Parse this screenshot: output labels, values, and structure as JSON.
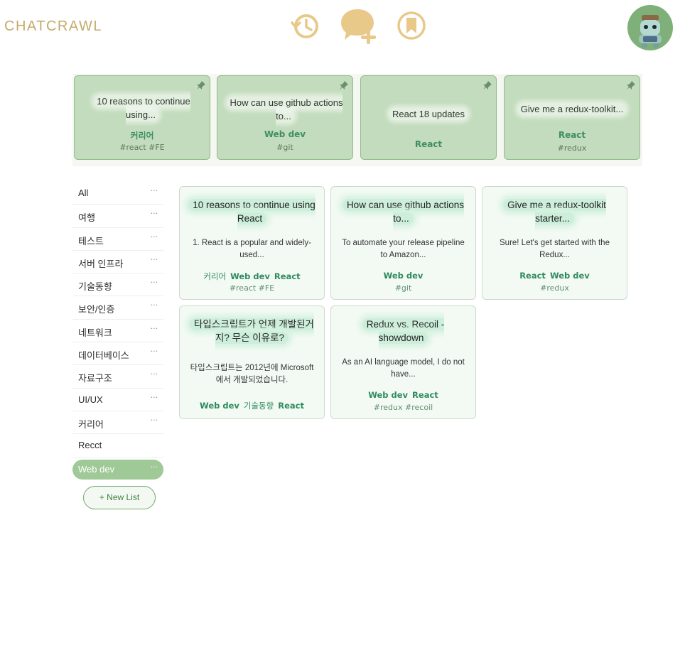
{
  "app": {
    "logo": "CHATCRAWL"
  },
  "nav": {
    "history_icon": "history-icon",
    "new_chat_icon": "new-chat-icon",
    "bookmark_icon": "bookmark-icon"
  },
  "colors": {
    "brand_gold": "#e8c98a",
    "accent_green": "#9fc996",
    "pinned_bg": "#c3dcbd",
    "tag_green": "#2f8a5d"
  },
  "pinned": [
    {
      "title": "10 reasons to continue using...",
      "category": "커리어",
      "tags": "#react #FE"
    },
    {
      "title": "How can use github actions to...",
      "category": "Web dev",
      "tags": "#git"
    },
    {
      "title": "React 18 updates",
      "category": "React",
      "tags": ""
    },
    {
      "title": "Give me a redux-toolkit...",
      "category": "React",
      "tags": "#redux"
    }
  ],
  "sidebar": {
    "items": [
      {
        "label": "All"
      },
      {
        "label": "여행"
      },
      {
        "label": "테스트"
      },
      {
        "label": "서버 인프라"
      },
      {
        "label": "기술동향"
      },
      {
        "label": "보안/인증"
      },
      {
        "label": "네트워크"
      },
      {
        "label": "데이터베이스"
      },
      {
        "label": "자료구조"
      },
      {
        "label": "UI/UX"
      },
      {
        "label": "커리어"
      },
      {
        "label": "Recct"
      },
      {
        "label": "Web dev"
      }
    ],
    "more_label": "···",
    "new_list_label": "+ New List"
  },
  "cards": [
    {
      "title": "10 reasons to continue using React",
      "body": "1. React is a popular and widely-used...",
      "cats": [
        "커리어",
        "Web dev",
        "React"
      ],
      "tags": "#react #FE"
    },
    {
      "title": "How can use github actions to...",
      "body": "To automate your release pipeline to Amazon...",
      "cats": [
        "Web dev"
      ],
      "tags": "#git"
    },
    {
      "title": "Give me a redux-toolkit starter...",
      "body": "Sure! Let's get started with the Redux...",
      "cats": [
        "React",
        "Web dev"
      ],
      "tags": "#redux"
    },
    {
      "title": "타입스크립트가 언제 개발된거지? 무슨 이유로?",
      "body": "타입스크립트는 2012년에 Microsoft에서 개발되었습니다.",
      "cats": [
        "Web dev",
        "기술동향",
        "React"
      ],
      "tags": ""
    },
    {
      "title": "Redux vs. Recoil - showdown",
      "body": "As an AI language model, I do not have...",
      "cats": [
        "Web dev",
        "React"
      ],
      "tags": "#redux #recoil"
    }
  ]
}
